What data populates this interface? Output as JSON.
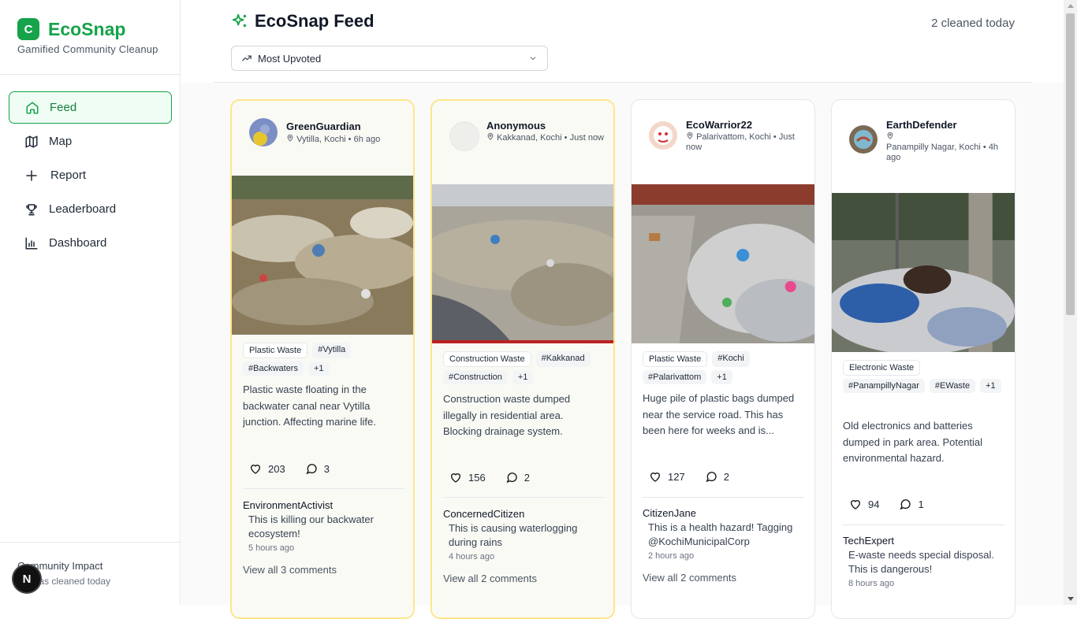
{
  "brand": {
    "logo_letter": "C",
    "name": "EcoSnap",
    "tagline": "Gamified Community Cleanup",
    "accent": "#16a34a"
  },
  "nav": [
    {
      "label": "Feed",
      "icon": "home-icon",
      "active": true
    },
    {
      "label": "Map",
      "icon": "map-icon"
    },
    {
      "label": "Report",
      "icon": "plus-icon"
    },
    {
      "label": "Leaderboard",
      "icon": "trophy-icon"
    },
    {
      "label": "Dashboard",
      "icon": "bar-chart-icon"
    }
  ],
  "impact": {
    "title": "Community Impact",
    "subtitle": "2 areas cleaned today",
    "badge": "N"
  },
  "header": {
    "title": "EcoSnap Feed",
    "count": "2 cleaned today",
    "sort_label": "Most Upvoted"
  },
  "posts": [
    {
      "user": "GreenGuardian",
      "location": "Vytilla, Kochi",
      "time": "6h ago",
      "tags": [
        "Plastic Waste",
        "#Vytilla",
        "#Backwaters",
        "+1"
      ],
      "description": "Plastic waste floating in the backwater canal near Vytilla junction. Affecting marine life.",
      "likes": "203",
      "comments": "3",
      "comment": {
        "user": "EnvironmentActivist",
        "text": "This is killing our backwater ecosystem!",
        "time": "5 hours ago"
      },
      "view_all": "View all 3 comments"
    },
    {
      "user": "Anonymous",
      "location": "Kakkanad, Kochi",
      "time": "Just now",
      "tags": [
        "Construction Waste",
        "#Kakkanad",
        "#Construction",
        "+1"
      ],
      "description": "Construction waste dumped illegally in residential area. Blocking drainage system.",
      "likes": "156",
      "comments": "2",
      "comment": {
        "user": "ConcernedCitizen",
        "text": "This is causing waterlogging during rains",
        "time": "4 hours ago"
      },
      "view_all": "View all 2 comments"
    },
    {
      "user": "EcoWarrior22",
      "location": "Palarivattom, Kochi",
      "time": "Just now",
      "tags": [
        "Plastic Waste",
        "#Kochi",
        "#Palarivattom",
        "+1"
      ],
      "description": "Huge pile of plastic bags dumped near the service road. This has been here for weeks and is...",
      "likes": "127",
      "comments": "2",
      "comment": {
        "user": "CitizenJane",
        "text": "This is a health hazard! Tagging @KochiMunicipalCorp",
        "time": "2 hours ago"
      },
      "view_all": "View all 2 comments"
    },
    {
      "user": "EarthDefender",
      "location": "Panampilly Nagar, Kochi",
      "time": "4h ago",
      "tags": [
        "Electronic Waste",
        "#PanampillyNagar",
        "#EWaste",
        "+1"
      ],
      "description": "Old electronics and batteries dumped in park area. Potential environmental hazard.",
      "likes": "94",
      "comments": "1",
      "comment": {
        "user": "TechExpert",
        "text": "E-waste needs special disposal. This is dangerous!",
        "time": "8 hours ago"
      }
    }
  ]
}
